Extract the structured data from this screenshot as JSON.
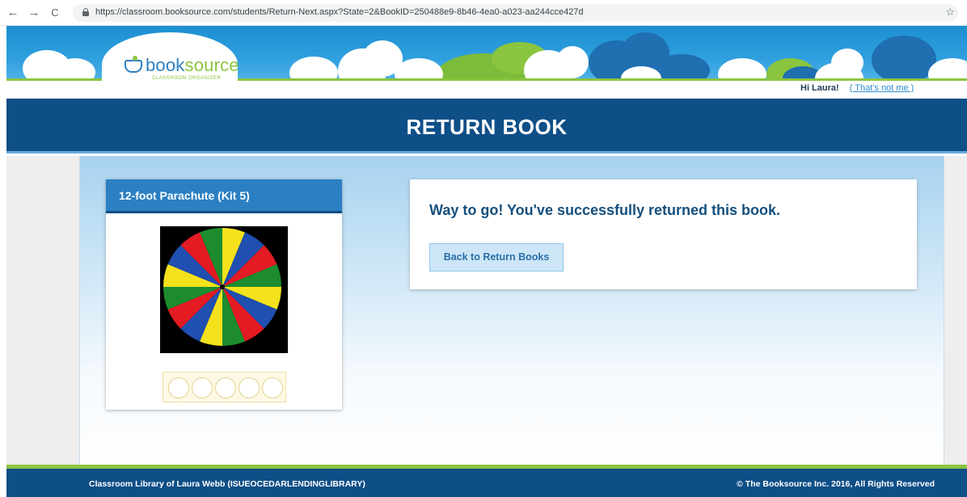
{
  "browser": {
    "back_icon": "←",
    "forward_icon": "→",
    "reload_icon": "C",
    "url": "https://classroom.booksource.com/students/Return-Next.aspx?State=2&BookID=250488e9-8b46-4ea0-a023-aa244cce427d",
    "star_icon": "☆"
  },
  "header": {
    "logo_word_1": "book",
    "logo_word_2": "source",
    "logo_tagline": "CLASSROOM ORGANIZER",
    "greeting": "Hi Laura!",
    "not_me_link": "( That's not me )"
  },
  "page": {
    "title": "RETURN BOOK"
  },
  "book": {
    "title": "12-foot Parachute (Kit 5)",
    "cover_colors": [
      "#e31b23",
      "#f5e21c",
      "#1f4fb0",
      "#1c8c2f"
    ],
    "rating_max": 5,
    "rating_value": 0
  },
  "result": {
    "message": "Way to go! You've successfully returned this book.",
    "back_button": "Back to Return Books"
  },
  "footer": {
    "left": "Classroom Library of Laura Webb (ISUEOCEDARLENDINGLIBRARY)",
    "right": "© The Booksource Inc. 2016, All Rights Reserved"
  },
  "colors": {
    "brand_blue": "#0f4f87",
    "accent_blue": "#2b80c3",
    "brand_green": "#8bc53f"
  }
}
